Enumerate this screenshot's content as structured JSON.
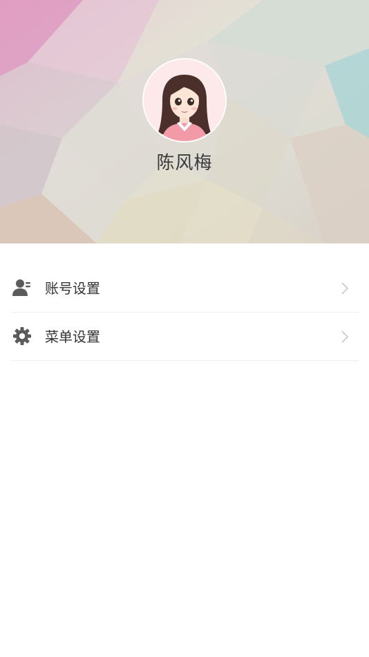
{
  "profile": {
    "name": "陈风梅",
    "avatar_icon": "girl-avatar-icon"
  },
  "menu": {
    "items": [
      {
        "label": "账号设置",
        "icon": "user-settings-icon"
      },
      {
        "label": "菜单设置",
        "icon": "gear-icon"
      }
    ]
  },
  "colors": {
    "text_primary": "#333333",
    "icon_gray": "#5b5b5b",
    "chevron": "#c8c8c8",
    "divider": "#efefef"
  }
}
